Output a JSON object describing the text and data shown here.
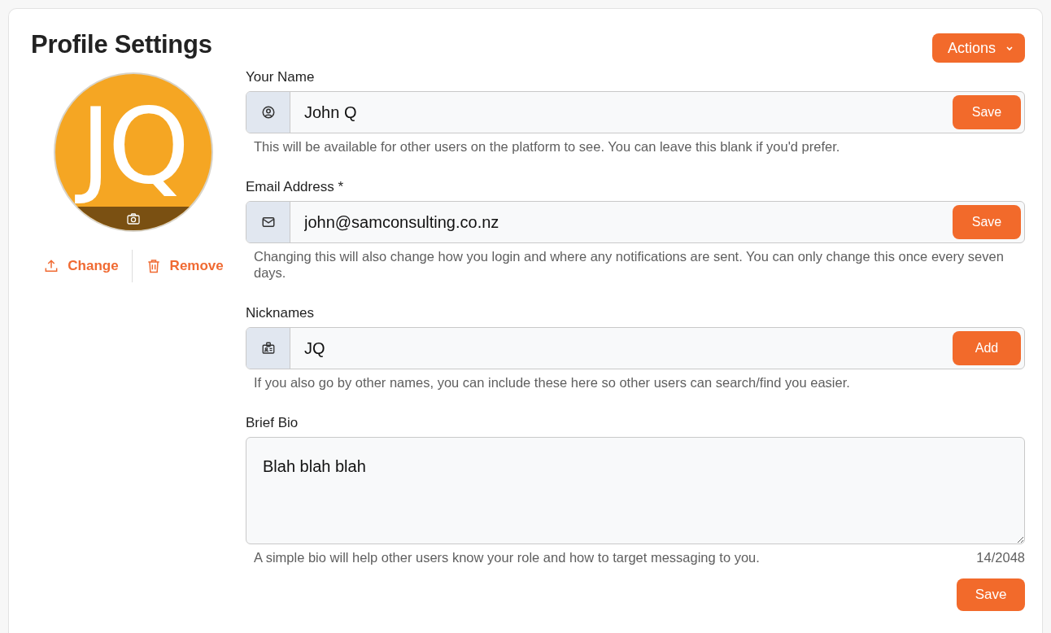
{
  "title": "Profile Settings",
  "actions_button": {
    "label": "Actions"
  },
  "avatar": {
    "initials": "JQ"
  },
  "avatar_actions": [
    {
      "kind": "upload",
      "label": "Change"
    },
    {
      "kind": "delete",
      "label": "Remove"
    }
  ],
  "fields": [
    {
      "kind": "input",
      "label": "Your Name",
      "value": "John Q",
      "button": "Save",
      "help": "This will be available for other users on the platform to see. You can leave this blank if you'd prefer."
    },
    {
      "kind": "input",
      "label": "Email Address *",
      "value": "john@samconsulting.co.nz",
      "button": "Save",
      "help": "Changing this will also change how you login and where any notifications are sent. You can only change this once every seven days."
    },
    {
      "kind": "input",
      "label": "Nicknames",
      "value": "JQ",
      "button": "Add",
      "help": "If you also go by other names, you can include these here so other users can search/find you easier."
    },
    {
      "kind": "textarea",
      "label": "Brief Bio",
      "value": "Blah blah blah",
      "help": "A simple bio will help other users know your role and how to target messaging to you.",
      "counter": "14/2048",
      "button": "Save"
    }
  ]
}
